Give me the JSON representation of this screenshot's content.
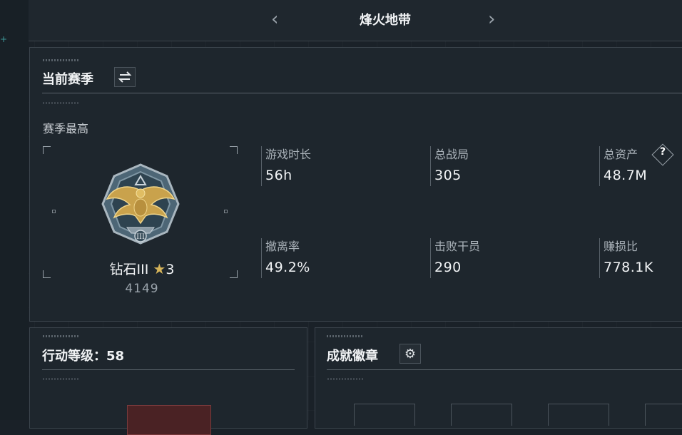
{
  "header": {
    "title": "烽火地带",
    "prev_icon": "chevron-left-icon",
    "next_icon": "chevron-right-icon"
  },
  "season": {
    "title": "当前赛季",
    "switch_icon": "swap-icon",
    "best_label": "赛季最高",
    "rank": {
      "name": "钻石III",
      "stars": "3",
      "star_icon": "star-icon",
      "score": "4149",
      "emblem_icon": "eagle-rank-emblem-icon"
    },
    "stats": [
      {
        "label": "游戏时长",
        "value": "56h"
      },
      {
        "label": "总战局",
        "value": "305"
      },
      {
        "label": "总资产",
        "value": "48.7M",
        "help": "?"
      },
      {
        "label": "撤离率",
        "value": "49.2%"
      },
      {
        "label": "击败干员",
        "value": "290"
      },
      {
        "label": "赚损比",
        "value": "778.1K"
      }
    ]
  },
  "level_panel": {
    "title": "行动等级：58"
  },
  "achievements": {
    "title": "成就徽章",
    "settings_icon": "gear-icon"
  },
  "colors": {
    "background": "#1a2128",
    "panel": "#1e262d",
    "border": "#3b444c",
    "accent_gold": "#d6b45a",
    "text": "#f2f4f6",
    "muted": "#9aa3ab"
  }
}
